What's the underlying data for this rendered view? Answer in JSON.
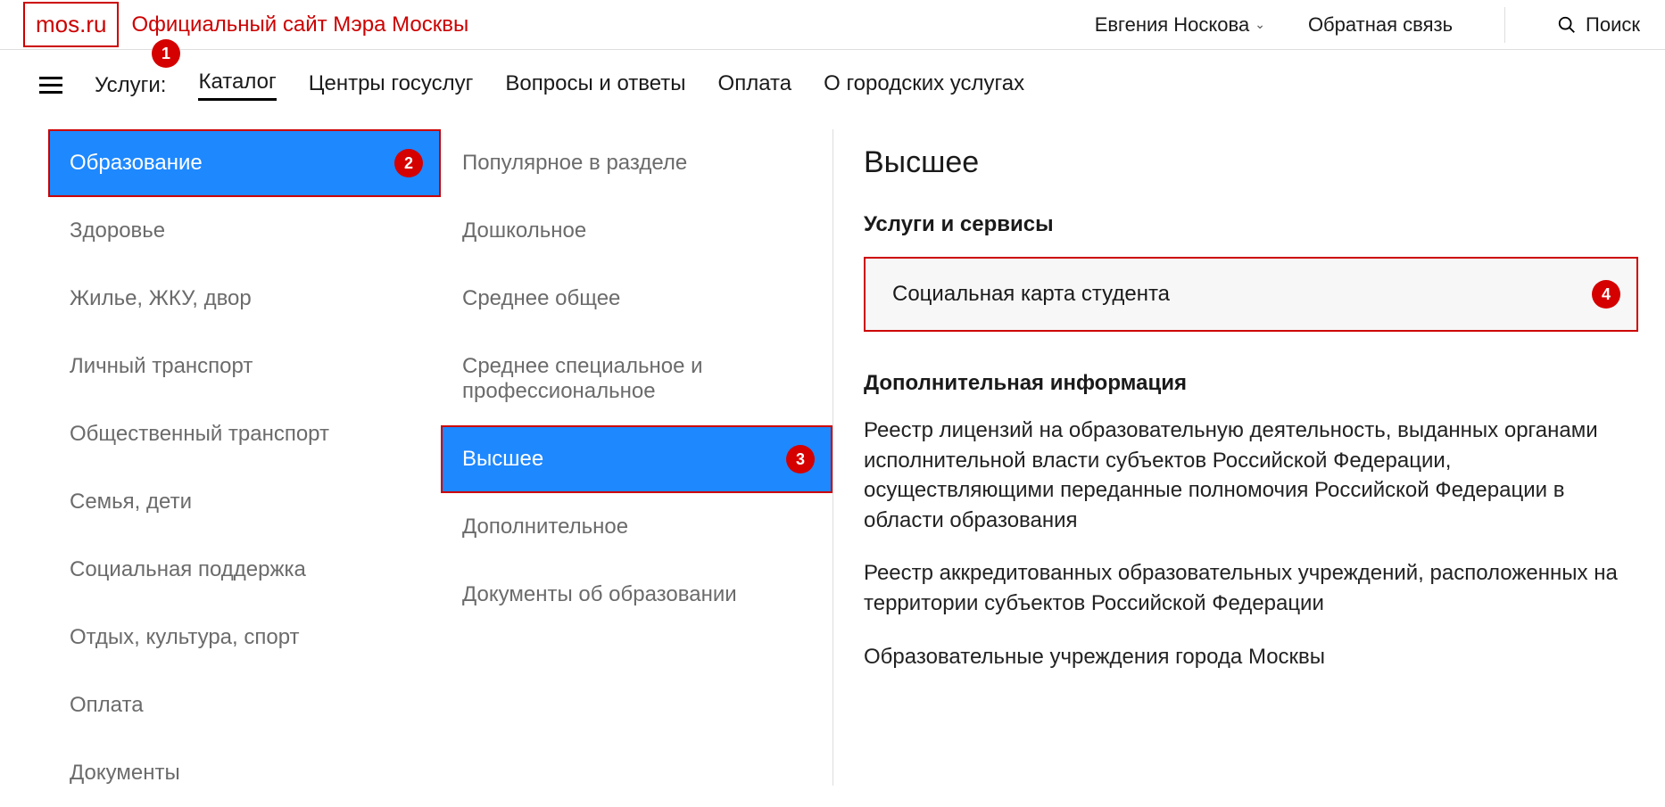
{
  "header": {
    "logo": "mos.ru",
    "tagline": "Официальный сайт Мэра Москвы",
    "user": "Евгения Носкова",
    "feedback": "Обратная связь",
    "search": "Поиск"
  },
  "nav": {
    "label": "Услуги:",
    "items": [
      "Каталог",
      "Центры госуслуг",
      "Вопросы и ответы",
      "Оплата",
      "О городских услугах"
    ],
    "active": 0
  },
  "column1": [
    "Образование",
    "Здоровье",
    "Жилье, ЖКУ, двор",
    "Личный транспорт",
    "Общественный транспорт",
    "Семья, дети",
    "Социальная поддержка",
    "Отдых, культура, спорт",
    "Оплата",
    "Документы"
  ],
  "column1_selected": 0,
  "column2": [
    "Популярное в разделе",
    "Дошкольное",
    "Среднее общее",
    "Среднее специальное и профессиональное",
    "Высшее",
    "Дополнительное",
    "Документы об образовании"
  ],
  "column2_selected": 4,
  "detail": {
    "title": "Высшее",
    "services_head": "Услуги и сервисы",
    "service_item": "Социальная карта студента",
    "additional_head": "Дополнительная информация",
    "info": [
      "Реестр лицензий на образовательную деятельность, выданных органами исполнительной власти субъектов Российской Федерации, осуществляющими переданные полномочия Российской Федерации в области образования",
      "Реестр аккредитованных образовательных учреждений, расположенных на территории субъектов Российской Федерации",
      "Образовательные учреждения города Москвы"
    ]
  },
  "steps": {
    "s1": "1",
    "s2": "2",
    "s3": "3",
    "s4": "4"
  }
}
